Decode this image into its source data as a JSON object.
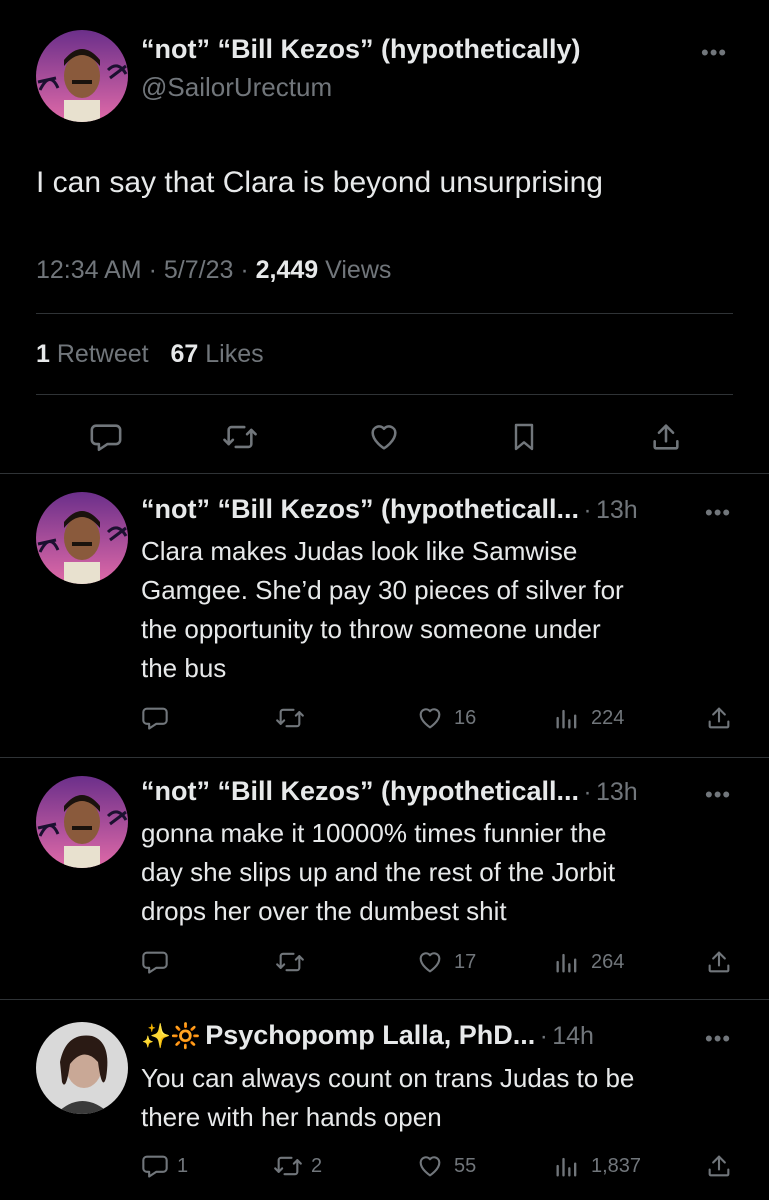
{
  "main_tweet": {
    "display_name": "“not” “Bill Kezos” (hypothetically)",
    "handle": "@SailorUrectum",
    "text": "I can say that Clara is beyond unsurprising",
    "time": "12:34 AM",
    "date": "5/7/23",
    "views_count": "2,449",
    "views_label": "Views",
    "retweets_count": "1",
    "retweets_label": "Retweet",
    "likes_count": "67",
    "likes_label": "Likes",
    "more": "•••",
    "sep": "·"
  },
  "actions": [
    "reply-icon",
    "retweet-icon",
    "like-icon",
    "bookmark-icon",
    "share-icon"
  ],
  "replies": [
    {
      "display_name": "“not” “Bill Kezos” (hypotheticall...",
      "time": "13h",
      "lines": [
        "Clara makes Judas look like Samwise",
        "Gamgee. She’d pay 30 pieces of silver for",
        "the opportunity to throw someone under",
        "the bus"
      ],
      "replies_count": "",
      "retweets_count": "",
      "likes_count": "16",
      "views_count": "224"
    },
    {
      "display_name": "“not” “Bill Kezos” (hypotheticall...",
      "time": "13h",
      "lines": [
        "gonna make it 10000% times funnier the",
        "day she slips up and the rest of the Jorbit",
        "drops her over the dumbest shit"
      ],
      "replies_count": "",
      "retweets_count": "",
      "likes_count": "17",
      "views_count": "264"
    },
    {
      "display_name": "Psychopomp Lalla, PhD...",
      "emoji": "✨🔆",
      "time": "14h",
      "lines": [
        "You can always count on trans Judas to be",
        "there with her hands open"
      ],
      "replies_count": "1",
      "retweets_count": "2",
      "likes_count": "55",
      "views_count": "1,837"
    }
  ],
  "colors": {
    "background": "#000000",
    "text": "#e7e9ea",
    "muted": "#71767b",
    "divider": "#2f3336"
  }
}
